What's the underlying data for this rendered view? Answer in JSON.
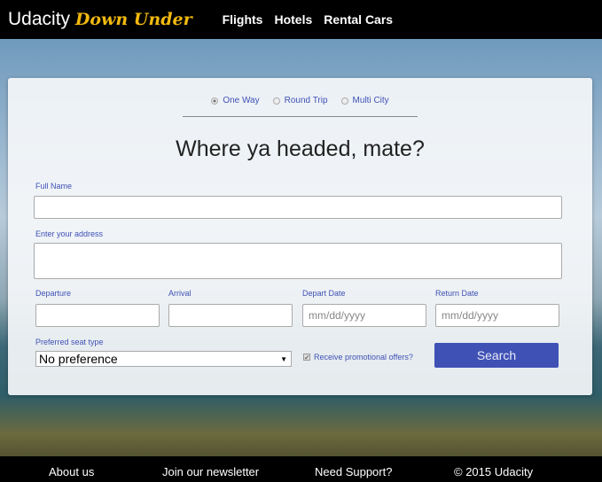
{
  "nav": {
    "brand": "Udacity",
    "brand_accent": "Down Under",
    "links": [
      "Flights",
      "Hotels",
      "Rental Cars"
    ]
  },
  "trip": {
    "options": [
      "One Way",
      "Round Trip",
      "Multi City"
    ],
    "selected": "One Way"
  },
  "title": "Where ya headed, mate?",
  "form": {
    "full_name_label": "Full Name",
    "full_name_value": "",
    "address_label": "Enter your address",
    "address_value": "",
    "departure_label": "Departure",
    "arrival_label": "Arrival",
    "depart_date_label": "Depart Date",
    "depart_date_placeholder": "mm/dd/yyyy",
    "return_date_label": "Return Date",
    "return_date_placeholder": "mm/dd/yyyy",
    "seat_label": "Preferred seat type",
    "seat_value": "No preference",
    "promo_label": "Receive promotional offers?",
    "promo_checked": true,
    "search_label": "Search"
  },
  "footer": [
    "About us",
    "Join our newsletter",
    "Need Support?",
    "© 2015 Udacity"
  ],
  "colors": {
    "accent": "#3f51b5",
    "brand_accent": "#f2b90f"
  }
}
